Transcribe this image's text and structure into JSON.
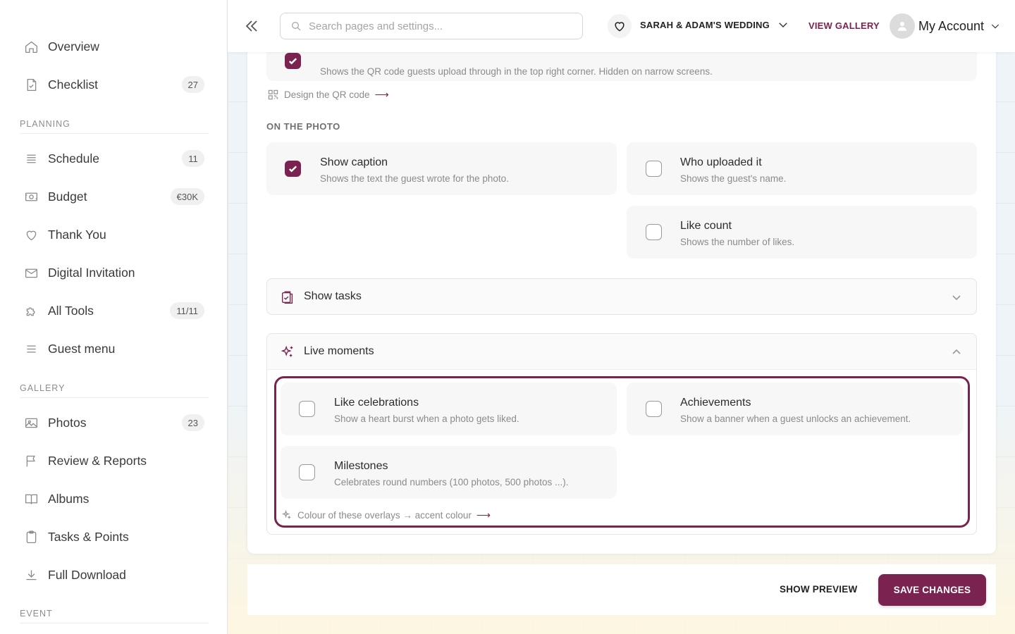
{
  "sidebar": {
    "items": [
      {
        "label": "Overview",
        "icon": "home-icon",
        "badge": ""
      },
      {
        "label": "Checklist",
        "icon": "checklist-icon",
        "badge": "27"
      }
    ],
    "sections": [
      {
        "title": "PLANNING",
        "items": [
          {
            "label": "Schedule",
            "icon": "schedule-icon",
            "badge": "11"
          },
          {
            "label": "Budget",
            "icon": "budget-icon",
            "badge": "€30K"
          },
          {
            "label": "Thank You",
            "icon": "heart-icon",
            "badge": ""
          },
          {
            "label": "Digital Invitation",
            "icon": "mail-icon",
            "badge": ""
          },
          {
            "label": "All Tools",
            "icon": "puzzle-icon",
            "badge": "11/11"
          },
          {
            "label": "Guest menu",
            "icon": "menu-icon",
            "badge": ""
          }
        ]
      },
      {
        "title": "GALLERY",
        "items": [
          {
            "label": "Photos",
            "icon": "photo-icon",
            "badge": "23"
          },
          {
            "label": "Review & Reports",
            "icon": "flag-icon",
            "badge": ""
          },
          {
            "label": "Albums",
            "icon": "book-icon",
            "badge": ""
          },
          {
            "label": "Tasks & Points",
            "icon": "clipboard-icon",
            "badge": ""
          },
          {
            "label": "Full Download",
            "icon": "download-icon",
            "badge": ""
          }
        ]
      },
      {
        "title": "EVENT",
        "items": []
      }
    ]
  },
  "topbar": {
    "search_placeholder": "Search pages and settings...",
    "event_name": "SARAH & ADAM'S WEDDING",
    "view_gallery": "VIEW GALLERY",
    "account": "My Account"
  },
  "content": {
    "qr_option": {
      "desc": "Shows the QR code guests upload through in the top right corner. Hidden on narrow screens.",
      "checked": true
    },
    "qr_link": "Design the QR code",
    "on_photo_label": "ON THE PHOTO",
    "on_photo": [
      {
        "title": "Show caption",
        "desc": "Shows the text the guest wrote for the photo.",
        "checked": true
      },
      {
        "title": "Who uploaded it",
        "desc": "Shows the guest's name.",
        "checked": false
      },
      {
        "title": "Like count",
        "desc": "Shows the number of likes.",
        "checked": false
      }
    ],
    "tasks_accordion": {
      "title": "Show tasks",
      "expanded": false
    },
    "live_accordion": {
      "title": "Live moments",
      "expanded": true
    },
    "live": [
      {
        "title": "Like celebrations",
        "desc": "Show a heart burst when a photo gets liked.",
        "checked": false
      },
      {
        "title": "Achievements",
        "desc": "Show a banner when a guest unlocks an achievement.",
        "checked": false
      },
      {
        "title": "Milestones",
        "desc": "Celebrates round numbers (100 photos, 500 photos ...).",
        "checked": false
      }
    ],
    "overlay_link": "Colour of these overlays → accent colour"
  },
  "footer": {
    "preview": "SHOW PREVIEW",
    "save": "SAVE CHANGES"
  },
  "colors": {
    "accent": "#7a2350",
    "badge_bg": "#f0f0f0",
    "option_bg": "#f7f7f7"
  }
}
